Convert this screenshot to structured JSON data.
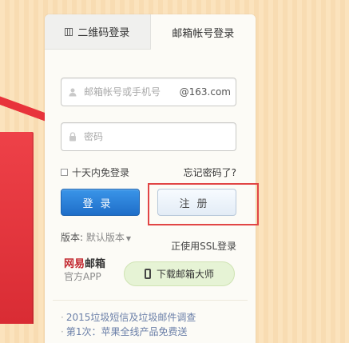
{
  "tabs": {
    "qr_login": "二维码登录",
    "email_login": "邮箱帐号登录"
  },
  "form": {
    "account_placeholder": "邮箱帐号或手机号",
    "account_suffix": "@163.com",
    "password_placeholder": "密码",
    "remember_label": "十天内免登录",
    "forgot_link": "忘记密码了?",
    "login_button": "登录",
    "register_button": "注册"
  },
  "footer": {
    "version_label": "版本:",
    "version_value": "默认版本",
    "ssl_link": "正使用SSL登录",
    "app_brand_main": "网易",
    "app_brand_mail": "邮箱",
    "app_brand_sub": "官方APP",
    "download_button": "下载邮箱大师"
  },
  "news": [
    "2015垃圾短信及垃圾邮件调查",
    "第1次：苹果全线产品免费送"
  ],
  "colors": {
    "login_button": "#2a7fd4",
    "highlight_box": "#e14545",
    "download_button_bg": "#e6f3d5"
  },
  "icons": {
    "qr": "qr-code-icon",
    "user": "user-icon",
    "lock": "lock-icon",
    "phone": "phone-icon",
    "caret": "caret-down-icon"
  }
}
